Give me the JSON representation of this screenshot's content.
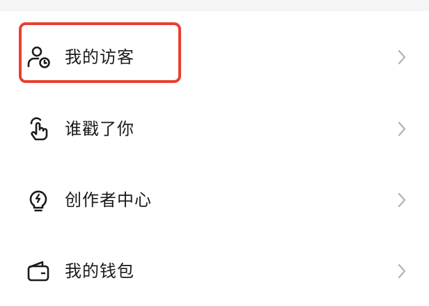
{
  "menu": {
    "items": [
      {
        "label": "我的访客",
        "icon": "user-clock-icon"
      },
      {
        "label": "谁戳了你",
        "icon": "tap-hand-icon"
      },
      {
        "label": "创作者中心",
        "icon": "lightbulb-bolt-icon"
      },
      {
        "label": "我的钱包",
        "icon": "wallet-icon"
      }
    ]
  },
  "colors": {
    "highlight": "#e8402f",
    "text": "#1a1a1a",
    "icon": "#1a1a1a",
    "chevron": "#b5b5b5",
    "top_strip": "#f5f5f5"
  }
}
